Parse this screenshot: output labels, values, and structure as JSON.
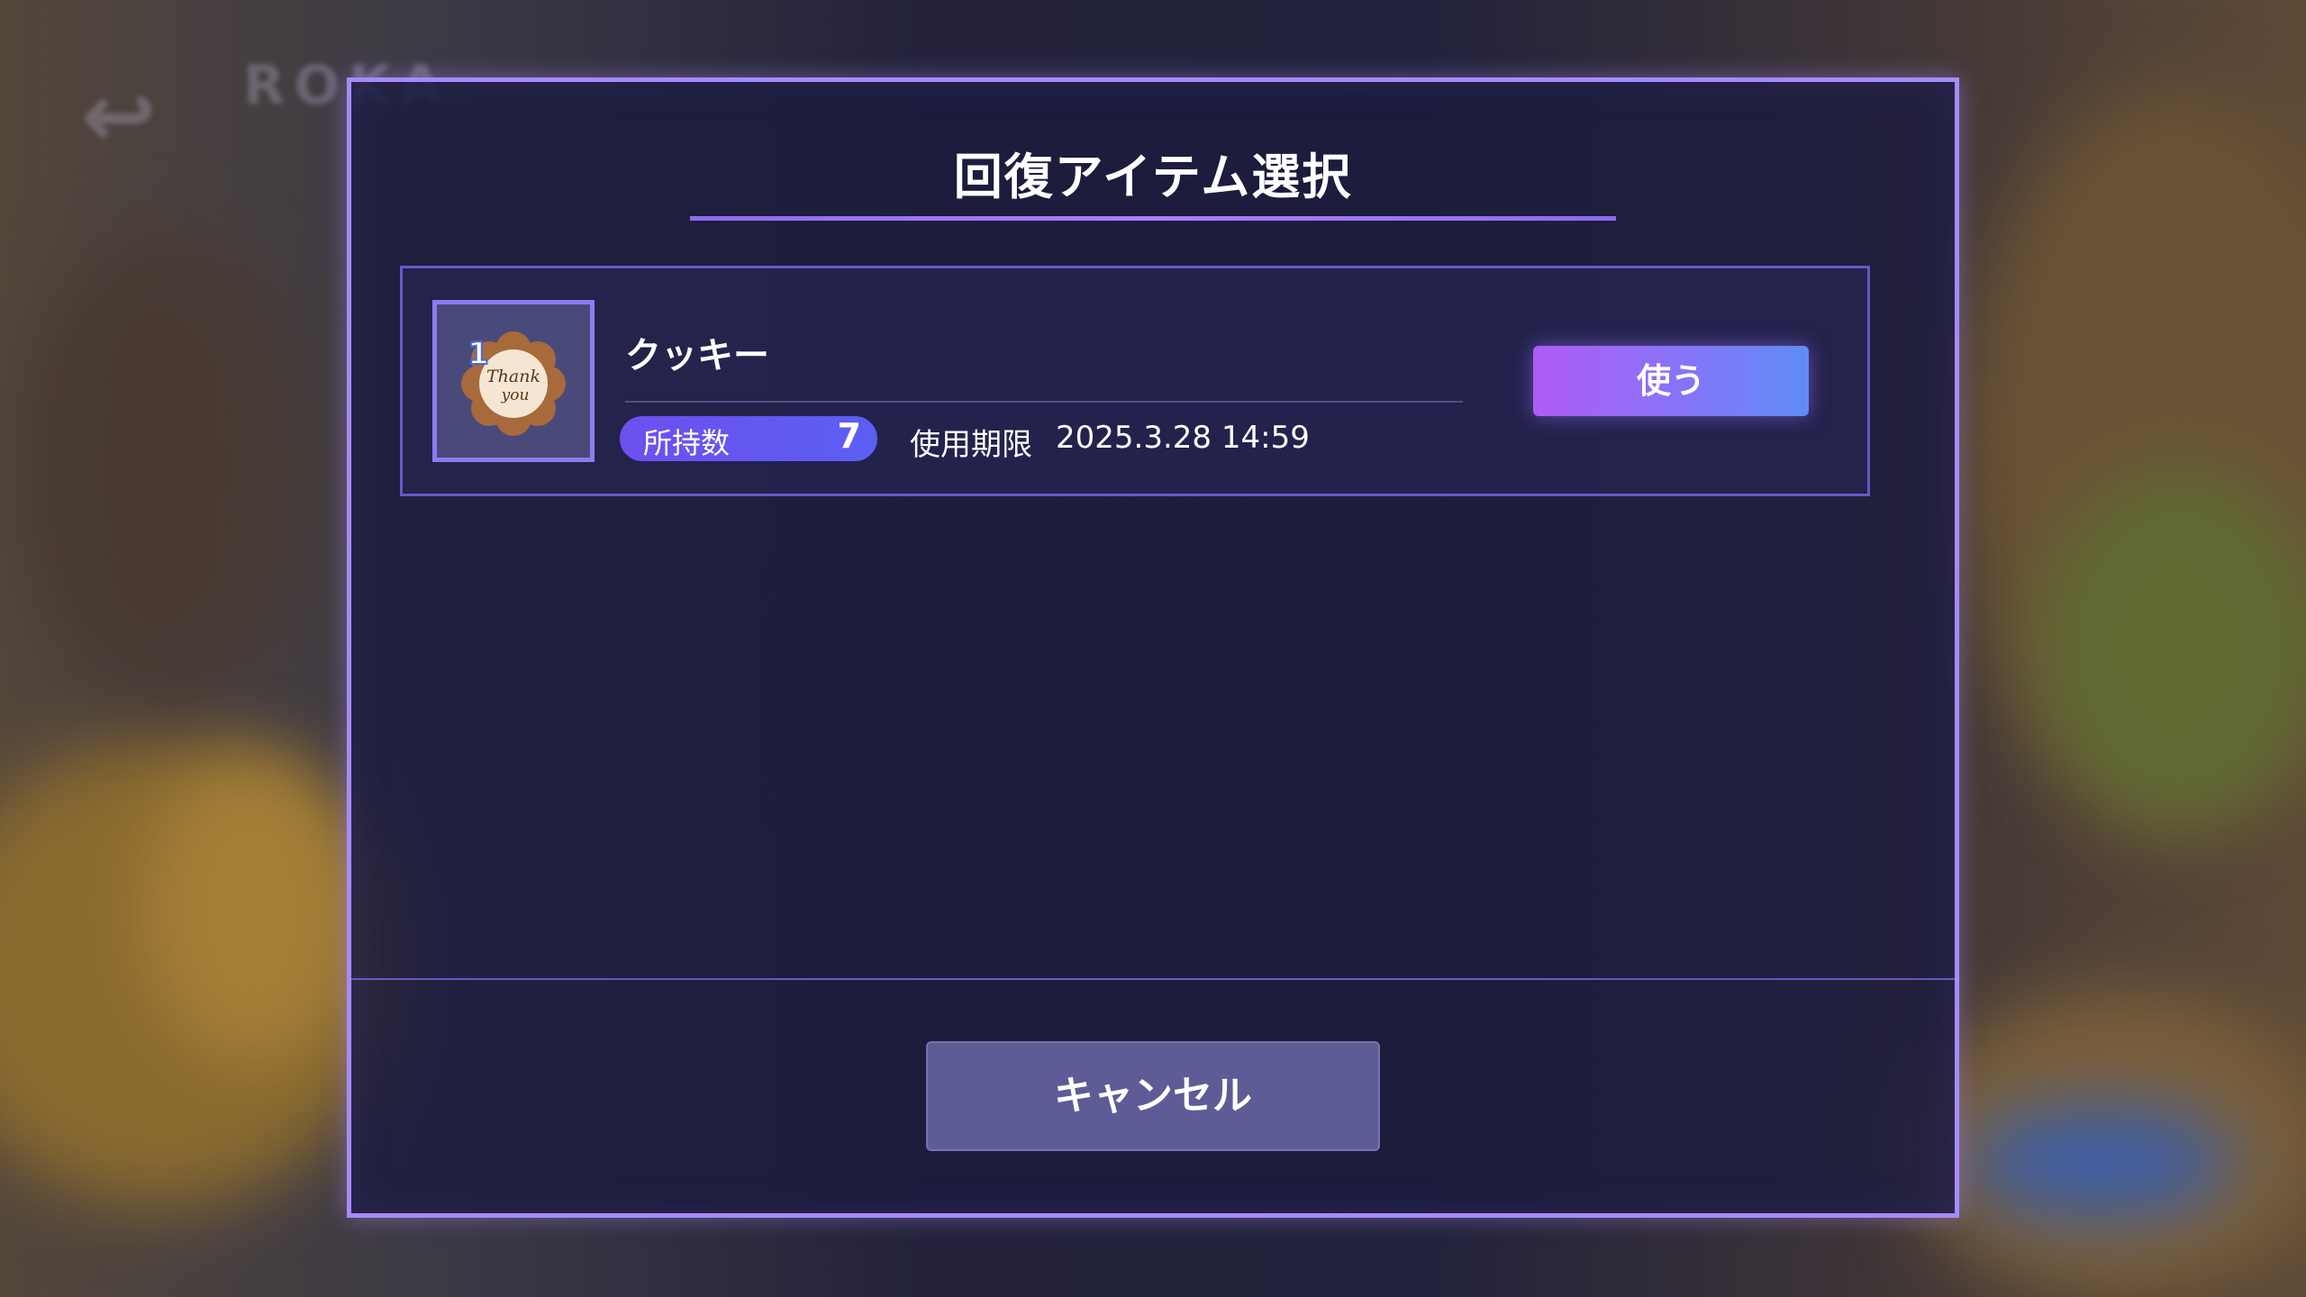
{
  "modal": {
    "title": "回復アイテム選択",
    "accent_color": "#a78bfa"
  },
  "item": {
    "name": "クッキー",
    "icon": "thank-you-cookie-icon",
    "icon_text_line1": "Thank",
    "icon_text_line2": "you",
    "badge_number": "1",
    "quantity_label": "所持数",
    "quantity_value": "7",
    "expiry_label": "使用期限",
    "expiry_value": "2025.3.28 14:59",
    "use_label": "使う"
  },
  "footer": {
    "cancel_label": "キャンセル"
  }
}
